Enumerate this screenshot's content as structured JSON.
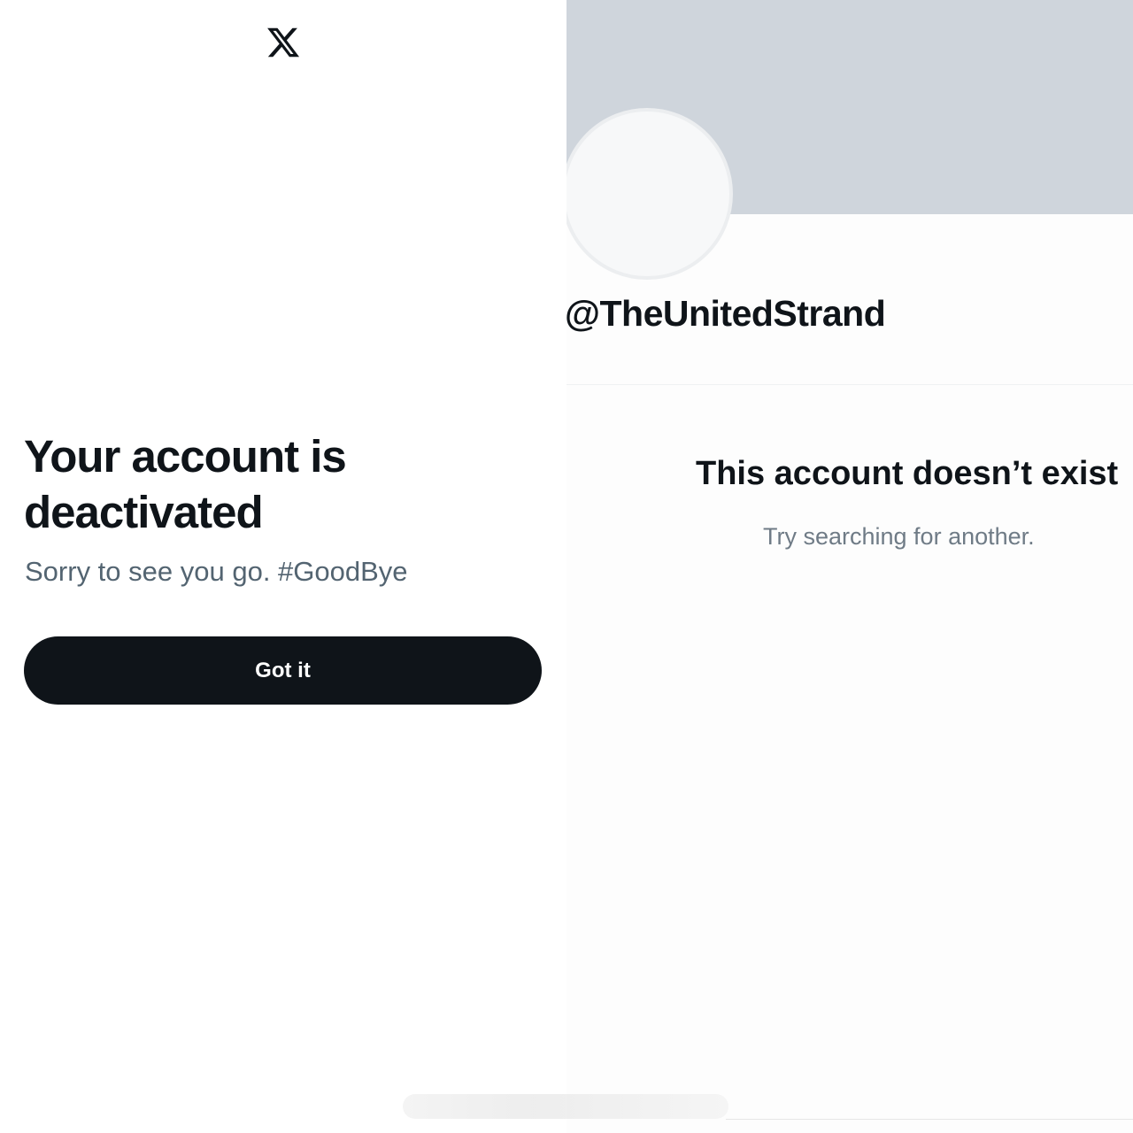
{
  "left": {
    "logo_icon": "x-logo-icon",
    "title": "Your account is deactivated",
    "subtitle": "Sorry to see you go. #GoodBye",
    "button_label": "Got it"
  },
  "right": {
    "handle": "@TheUnitedStrand",
    "title": "This account doesn’t exist",
    "subtitle": "Try searching for another."
  },
  "colors": {
    "text_primary": "#0f1419",
    "text_secondary": "#536471",
    "button_bg": "#0f1419",
    "banner": "#cfd5dc"
  }
}
